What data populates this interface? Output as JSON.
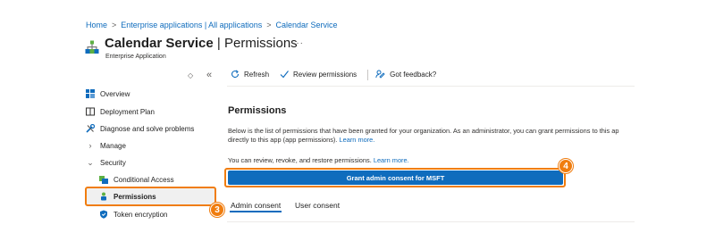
{
  "breadcrumb": {
    "items": [
      "Home",
      "Enterprise applications | All applications",
      "Calendar Service"
    ],
    "separator": ">"
  },
  "header": {
    "title_main": "Calendar Service",
    "title_section": "| Permissions",
    "more": "···",
    "subtitle": "Enterprise Application"
  },
  "sidebar": {
    "collapse_up": "◇",
    "collapse_left": "«",
    "items": [
      {
        "label": "Overview",
        "icon": "overview-icon"
      },
      {
        "label": "Deployment Plan",
        "icon": "book-icon"
      },
      {
        "label": "Diagnose and solve problems",
        "icon": "wrench-icon"
      },
      {
        "label": "Manage",
        "icon": "chevron-right-icon"
      },
      {
        "label": "Security",
        "icon": "chevron-down-icon"
      },
      {
        "label": "Conditional Access",
        "icon": "conditional-access-icon"
      },
      {
        "label": "Permissions",
        "icon": "permissions-icon"
      },
      {
        "label": "Token encryption",
        "icon": "shield-icon"
      }
    ]
  },
  "toolbar": {
    "refresh": "Refresh",
    "review": "Review permissions",
    "feedback": "Got feedback?"
  },
  "main": {
    "section_title": "Permissions",
    "desc1": "Below is the list of permissions that have been granted for your organization. As an administrator, you can grant permissions to this ap",
    "desc2_text": "directly to this app (app permissions).",
    "desc2_link": "Learn more.",
    "desc3_text": "You can review, revoke, and restore permissions.",
    "desc3_link": "Learn more.",
    "grant_button": "Grant admin consent for MSFT",
    "tabs": [
      "Admin consent",
      "User consent"
    ]
  },
  "callouts": {
    "three": "3",
    "four": "4"
  },
  "colors": {
    "accent": "#0f6cbd",
    "callout": "#f07d0f"
  }
}
